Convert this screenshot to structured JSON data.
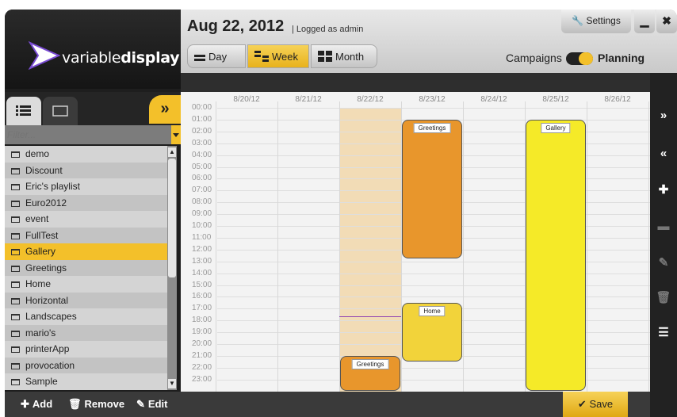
{
  "app": {
    "brand_light": "variable",
    "brand_bold": "display"
  },
  "header": {
    "date": "Aug 22, 2012",
    "login_status": "| Logged as admin",
    "settings_label": "Settings",
    "views": {
      "day": "Day",
      "week": "Week",
      "month": "Month"
    },
    "active_view": "Week",
    "campaigns_label": "Campaigns",
    "planning_label": "Planning",
    "toggle_state": "Planning"
  },
  "sidebar": {
    "filter_placeholder": "Filter...",
    "campaigns": [
      "demo",
      "Discount",
      "Eric's playlist",
      "Euro2012",
      "event",
      "FullTest",
      "Gallery",
      "Greetings",
      "Home",
      "Horizontal",
      "Landscapes",
      "mario's",
      "printerApp",
      "provocation",
      "Sample"
    ],
    "selected": "Gallery",
    "actions": {
      "add": "Add",
      "remove": "Remove",
      "edit": "Edit"
    },
    "expand_glyph": "»"
  },
  "calendar": {
    "days": [
      "8/20/12",
      "8/21/12",
      "8/22/12",
      "8/23/12",
      "8/24/12",
      "8/25/12",
      "8/26/12"
    ],
    "today": "8/22/12",
    "hours": [
      "00:00",
      "01:00",
      "02:00",
      "03:00",
      "04:00",
      "05:00",
      "06:00",
      "07:00",
      "08:00",
      "09:00",
      "10:00",
      "11:00",
      "12:00",
      "13:00",
      "14:00",
      "15:00",
      "16:00",
      "17:00",
      "18:00",
      "19:00",
      "20:00",
      "21:00",
      "22:00",
      "23:00"
    ],
    "events": [
      {
        "label": "Greetings",
        "day": "8/23/12",
        "start": "01:00",
        "end": "12:45",
        "color": "#e8962c"
      },
      {
        "label": "Home",
        "day": "8/23/12",
        "start": "16:30",
        "end": "21:30",
        "color": "#f2d33a"
      },
      {
        "label": "Greetings",
        "day": "8/22/12",
        "start": "21:00",
        "end": "23:59",
        "color": "#e8962c"
      },
      {
        "label": "Gallery",
        "day": "8/25/12",
        "start": "01:00",
        "end": "23:59",
        "color": "#f5ea28"
      }
    ],
    "current_time": "17:40"
  },
  "toolbar_right": {
    "forward_glyph": "»",
    "back_glyph": "«"
  },
  "footer": {
    "save_label": "Save"
  },
  "colors": {
    "accent": "#f3c02a",
    "today_bg": "#f2dcb6"
  }
}
